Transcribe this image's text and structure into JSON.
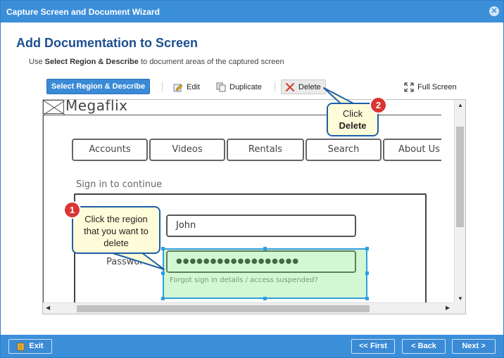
{
  "window": {
    "title": "Capture Screen and Document Wizard",
    "close_glyph": "✕"
  },
  "header": {
    "heading": "Add Documentation to Screen",
    "instr_prefix": "Use ",
    "instr_bold": "Select Region & Describe",
    "instr_suffix": " to document areas of the captured screen"
  },
  "toolbar": {
    "select_region_label": "Select Region & Describe",
    "edit_label": "Edit",
    "duplicate_label": "Duplicate",
    "delete_label": "Delete",
    "fullscreen_label": "Full Screen"
  },
  "mockup": {
    "logo_text": "Megaflix",
    "nav_tabs": [
      "Accounts",
      "Videos",
      "Rentals",
      "Search",
      "About Us"
    ],
    "signin_text": "Sign in to continue",
    "username_value": "John",
    "password_label": "Password",
    "password_value": "●●●●●●●●●●●●●●●●●●",
    "forgot_text": "Forgot sign in details / access suspended?"
  },
  "callouts": {
    "one_badge": "1",
    "one_text": "Click the region that you want to delete",
    "two_badge": "2",
    "two_text_plain": "Click",
    "two_text_bold": "Delete"
  },
  "footer": {
    "exit_label": "Exit",
    "first_label": "<< First",
    "back_label": "< Back",
    "next_label": "Next >"
  },
  "colors": {
    "accent": "#3b8fd9",
    "heading": "#1d4f8f",
    "badge": "#d83535",
    "callout_bg": "#fffcd9",
    "selection": "#2f9ee0"
  }
}
